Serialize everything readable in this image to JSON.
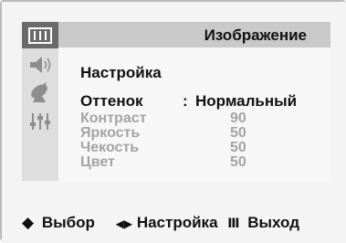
{
  "menu": {
    "title": "Изображение",
    "section_label": "Настройка",
    "items": [
      {
        "label": "Оттенок",
        "separator": ":",
        "value": "Нормальный",
        "state": "active"
      },
      {
        "label": "Контраст",
        "value": "90",
        "state": "disabled"
      },
      {
        "label": "Яркость",
        "value": "50",
        "state": "disabled"
      },
      {
        "label": "Чекость",
        "value": "50",
        "state": "disabled"
      },
      {
        "label": "Цвет",
        "value": "50",
        "state": "disabled"
      }
    ]
  },
  "sidebar": {
    "icons": [
      "picture-icon",
      "speaker-icon",
      "antenna-icon",
      "settings-sliders-icon"
    ],
    "active_index": 0
  },
  "footer": {
    "select_glyph": "◆",
    "select_label": "Выбор",
    "adjust_glyph": "◀▶",
    "adjust_label": "Настройка",
    "exit_glyph": "Ⅲ",
    "exit_label": "Выход"
  },
  "colors": {
    "active_text": "#111111",
    "disabled_text": "#a4a4a4",
    "title_bar": "#c9c9c9",
    "icon_column": "#dedede",
    "active_icon_bg": "#6a6a6a"
  }
}
